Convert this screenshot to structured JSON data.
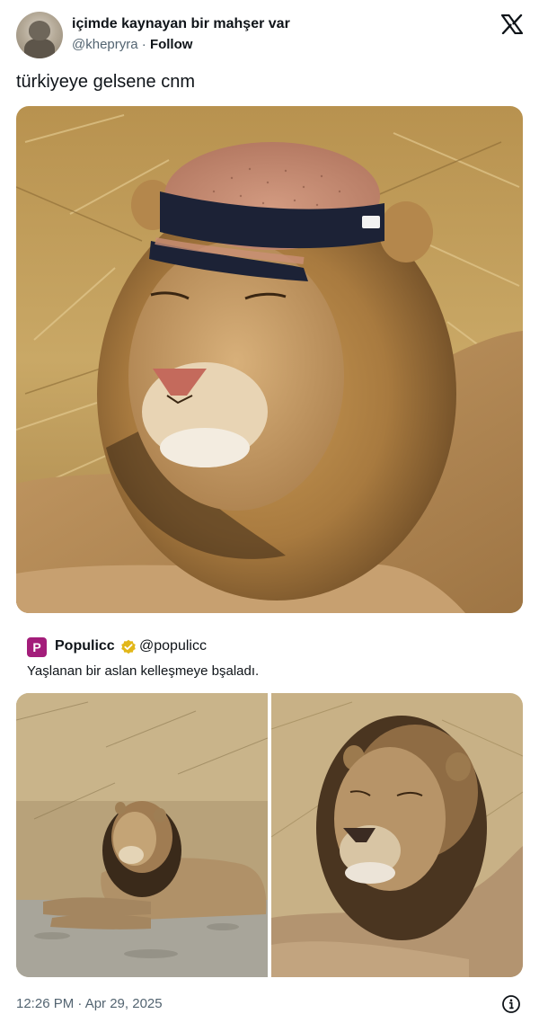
{
  "author": {
    "display_name": "içimde kaynayan bir mahşer var",
    "handle": "@khepryra",
    "separator": "·",
    "follow_label": "Follow"
  },
  "tweet": {
    "text": "türkiyeye gelsene cnm",
    "timestamp": "12:26 PM · Apr 29, 2025"
  },
  "quoted_tweet": {
    "logo_letter": "P",
    "display_name": "Populicc",
    "handle": "@populicc",
    "text": "Yaşlanan bir aslan kelleşmeye bşaladı."
  },
  "icons": {
    "platform_logo": "x-logo-icon",
    "verified": "verified-badge-icon",
    "info": "info-icon"
  },
  "colors": {
    "text_primary": "#0f1419",
    "text_secondary": "#536471",
    "quote_brand": "#a31d7a",
    "verified_gold": "#e2b719"
  }
}
